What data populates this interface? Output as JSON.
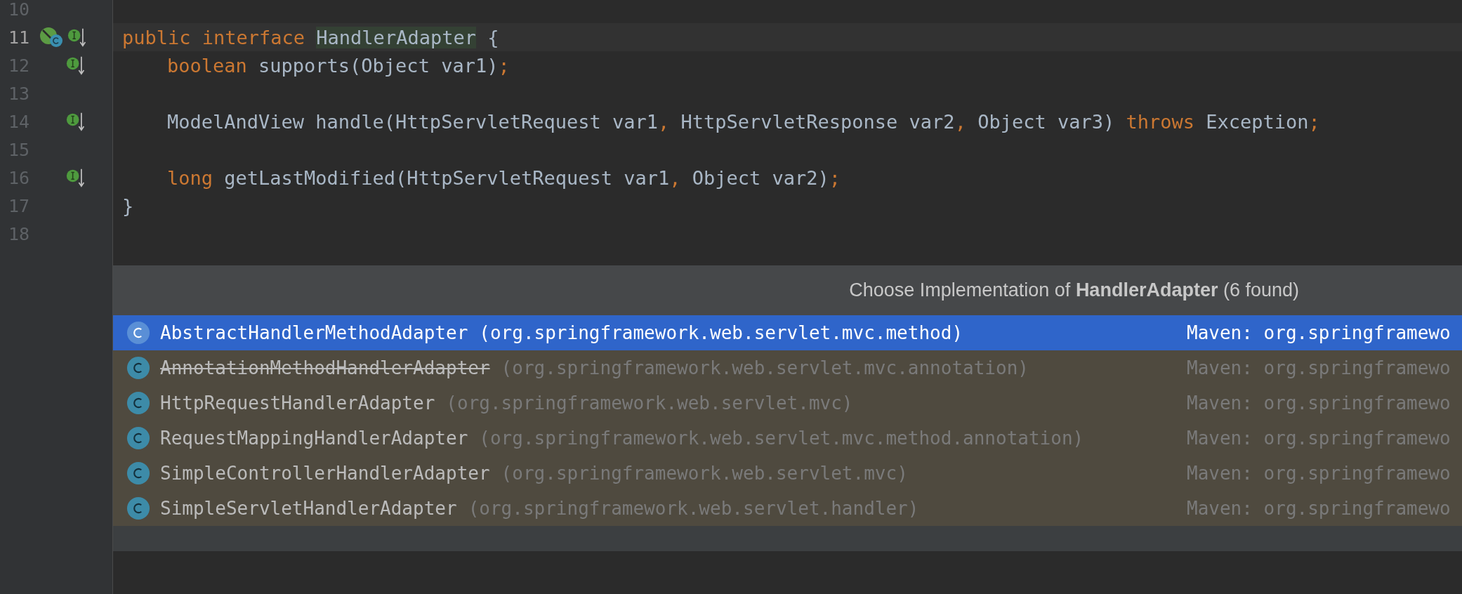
{
  "editor": {
    "lines": [
      {
        "number": "10",
        "current": false
      },
      {
        "number": "11",
        "current": true,
        "indented": false,
        "gutter_icons": [
          {
            "kind": "bean-class"
          },
          {
            "kind": "implemented"
          }
        ],
        "tokens": [
          {
            "text": "public interface ",
            "kind": "keyword"
          },
          {
            "text": "HandlerAdapter",
            "kind": "highlight"
          },
          {
            "text": " {",
            "kind": "plain"
          }
        ]
      },
      {
        "number": "12",
        "current": false,
        "indented": true,
        "gutter_icons": [
          {
            "kind": "implemented"
          }
        ],
        "tokens": [
          {
            "text": "boolean",
            "kind": "keyword"
          },
          {
            "text": " supports(Object var1)",
            "kind": "plain"
          },
          {
            "text": ";",
            "kind": "punct"
          }
        ]
      },
      {
        "number": "13",
        "current": false
      },
      {
        "number": "14",
        "current": false,
        "indented": true,
        "gutter_icons": [
          {
            "kind": "implemented"
          }
        ],
        "tokens": [
          {
            "text": "ModelAndView handle(HttpServletRequest var1",
            "kind": "plain"
          },
          {
            "text": ", ",
            "kind": "punct"
          },
          {
            "text": "HttpServletResponse var2",
            "kind": "plain"
          },
          {
            "text": ", ",
            "kind": "punct"
          },
          {
            "text": "Object var3) ",
            "kind": "plain"
          },
          {
            "text": "throws",
            "kind": "keyword"
          },
          {
            "text": " Exception",
            "kind": "plain"
          },
          {
            "text": ";",
            "kind": "punct"
          }
        ]
      },
      {
        "number": "15",
        "current": false
      },
      {
        "number": "16",
        "current": false,
        "indented": true,
        "gutter_icons": [
          {
            "kind": "implemented"
          }
        ],
        "tokens": [
          {
            "text": "long",
            "kind": "keyword"
          },
          {
            "text": " getLastModified(HttpServletRequest var1",
            "kind": "plain"
          },
          {
            "text": ", ",
            "kind": "punct"
          },
          {
            "text": "Object var2)",
            "kind": "plain"
          },
          {
            "text": ";",
            "kind": "punct"
          }
        ]
      },
      {
        "number": "17",
        "current": false,
        "indented": false,
        "tokens": [
          {
            "text": "}",
            "kind": "plain"
          }
        ]
      },
      {
        "number": "18",
        "current": false
      }
    ]
  },
  "popup": {
    "title": "Choose Implementation of **HandlerAdapter** (6 found)",
    "items": [
      {
        "name": "AbstractHandlerMethodAdapter",
        "package": "(org.springframework.web.servlet.mvc.method)",
        "library": "Maven: org.springframewo",
        "selected": true,
        "deprecated": false
      },
      {
        "name": "AnnotationMethodHandlerAdapter",
        "package": "(org.springframework.web.servlet.mvc.annotation)",
        "library": "Maven: org.springframewo",
        "selected": false,
        "deprecated": true
      },
      {
        "name": "HttpRequestHandlerAdapter",
        "package": "(org.springframework.web.servlet.mvc)",
        "library": "Maven: org.springframewo",
        "selected": false,
        "deprecated": false
      },
      {
        "name": "RequestMappingHandlerAdapter",
        "package": "(org.springframework.web.servlet.mvc.method.annotation)",
        "library": "Maven: org.springframewo",
        "selected": false,
        "deprecated": false
      },
      {
        "name": "SimpleControllerHandlerAdapter",
        "package": "(org.springframework.web.servlet.mvc)",
        "library": "Maven: org.springframewo",
        "selected": false,
        "deprecated": false
      },
      {
        "name": "SimpleServletHandlerAdapter",
        "package": "(org.springframework.web.servlet.handler)",
        "library": "Maven: org.springframewo",
        "selected": false,
        "deprecated": false
      }
    ]
  }
}
